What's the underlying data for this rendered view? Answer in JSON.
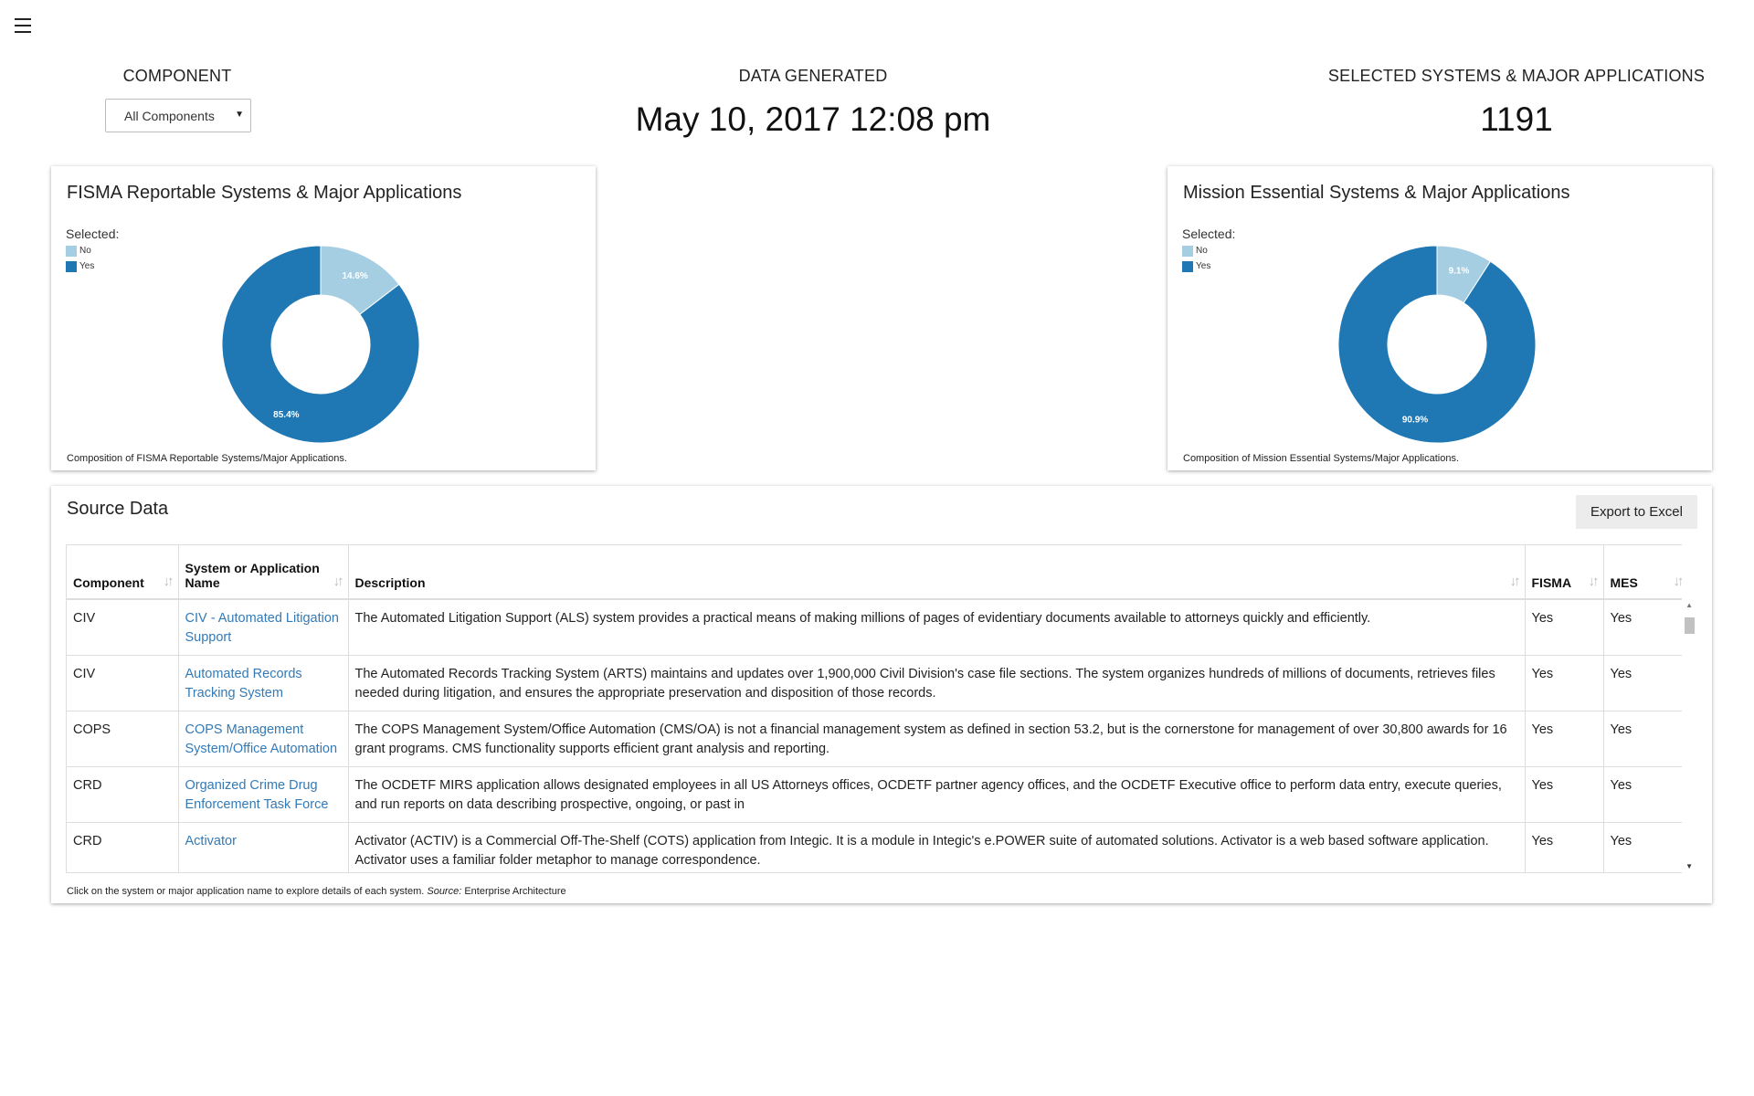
{
  "header": {
    "component_label": "COMPONENT",
    "component_select_value": "All Components",
    "date_label": "DATA GENERATED",
    "date_value": "May 10, 2017 12:08 pm",
    "count_label": "SELECTED SYSTEMS & MAJOR APPLICATIONS",
    "count_value": "1191"
  },
  "fisma_card": {
    "title": "FISMA Reportable Systems & Major Applications",
    "legend_title": "Selected:",
    "legend_no": "No",
    "legend_yes": "Yes",
    "caption": "Composition of FISMA Reportable Systems/Major Applications.",
    "no_label": "14.6%",
    "yes_label": "85.4%"
  },
  "mes_card": {
    "title": "Mission Essential Systems & Major Applications",
    "legend_title": "Selected:",
    "legend_no": "No",
    "legend_yes": "Yes",
    "caption": "Composition of Mission Essential Systems/Major Applications.",
    "no_label": "9.1%",
    "yes_label": "90.9%"
  },
  "colors": {
    "no": "#a6cee3",
    "yes": "#1f78b4",
    "link": "#337ab7"
  },
  "chart_data": [
    {
      "type": "pie",
      "title": "FISMA Reportable Systems & Major Applications",
      "categories": [
        "No",
        "Yes"
      ],
      "values": [
        14.6,
        85.4
      ],
      "legend": "top-left"
    },
    {
      "type": "pie",
      "title": "Mission Essential Systems & Major Applications",
      "categories": [
        "No",
        "Yes"
      ],
      "values": [
        9.1,
        90.9
      ],
      "legend": "top-left"
    }
  ],
  "source": {
    "title": "Source Data",
    "export_label": "Export to Excel",
    "columns": [
      "Component",
      "System or Application Name",
      "Description",
      "FISMA",
      "MES"
    ],
    "rows": [
      [
        "CIV",
        "CIV - Automated Litigation Support",
        "The Automated Litigation Support (ALS) system provides a practical means of making millions of pages of evidentiary documents available to attorneys quickly and efficiently.",
        "Yes",
        "Yes"
      ],
      [
        "CIV",
        "Automated Records Tracking System",
        "The Automated Records Tracking System (ARTS) maintains and updates over 1,900,000 Civil Division's case file sections. The system organizes hundreds of millions of documents, retrieves files needed during litigation, and ensures the appropriate preservation and disposition of those records.",
        "Yes",
        "Yes"
      ],
      [
        "COPS",
        "COPS Management System/Office Automation",
        "The COPS Management System/Office Automation (CMS/OA) is not a financial management system as defined in section 53.2, but is the cornerstone for management of over 30,800 awards for 16 grant programs. CMS functionality supports efficient grant analysis and reporting.",
        "Yes",
        "Yes"
      ],
      [
        "CRD",
        "Organized Crime Drug Enforcement Task Force",
        "The OCDETF MIRS application allows designated employees in all US Attorneys offices, OCDETF partner agency offices, and the OCDETF Executive office to perform data entry, execute queries, and run reports on data describing prospective, ongoing, or past in",
        "Yes",
        "Yes"
      ],
      [
        "CRD",
        "Activator",
        "Activator (ACTIV) is a Commercial Off-The-Shelf (COTS) application from Integic. It is a module in Integic's e.POWER suite of automated solutions. Activator is a web based software application. Activator uses a familiar folder metaphor to manage correspondence.",
        "Yes",
        "Yes"
      ]
    ],
    "footer_prefix": "Click on the system or major application name to explore details of each system.",
    "footer_source_label": "Source:",
    "footer_source_value": "Enterprise Architecture"
  }
}
